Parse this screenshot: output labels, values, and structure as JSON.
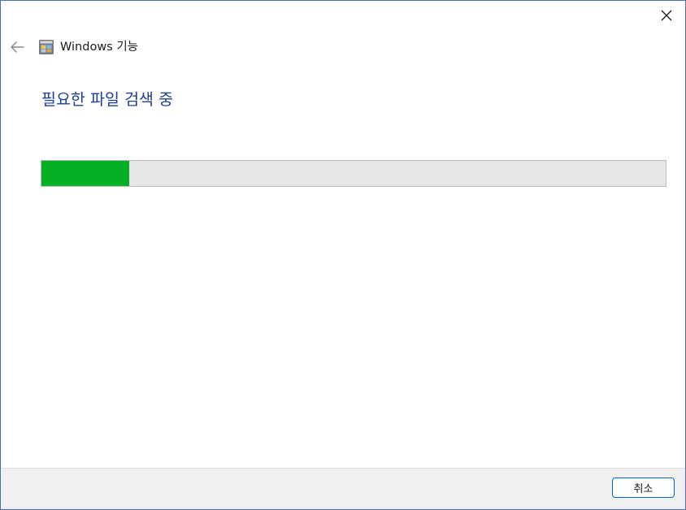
{
  "window": {
    "title": "Windows 기능"
  },
  "main": {
    "heading": "필요한 파일 검색 중",
    "progress": {
      "value": 0.14,
      "fill_color": "#06b025",
      "track_color": "#e6e6e6"
    }
  },
  "footer": {
    "cancel_label": "취소"
  },
  "icons": {
    "close": "close-icon",
    "back": "back-arrow-icon",
    "app": "windows-features-icon"
  }
}
